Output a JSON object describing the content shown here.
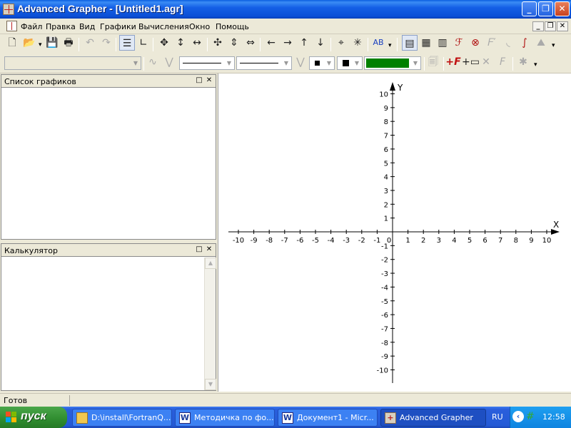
{
  "window": {
    "title": "Advanced Grapher - [Untitled1.agr]",
    "buttons": {
      "minimize": "_",
      "maximize": "❐",
      "close": "✕"
    }
  },
  "menu": {
    "items": [
      "Файл",
      "Правка",
      "Вид",
      "Графики",
      "Вычисления",
      "Окно",
      "Помощь"
    ],
    "mdi": {
      "minimize": "_",
      "restore": "❐",
      "close": "✕"
    }
  },
  "toolbar1": {
    "format_label": "AB"
  },
  "panels": {
    "graphs_list": {
      "title": "Список графиков"
    },
    "calculator": {
      "title": "Калькулятор"
    }
  },
  "graph": {
    "x_axis_label": "X",
    "y_axis_label": "Y",
    "x_ticks": [
      -10,
      -9,
      -8,
      -7,
      -6,
      -5,
      -4,
      -3,
      -2,
      -1,
      0,
      1,
      2,
      3,
      4,
      5,
      6,
      7,
      8,
      9,
      10
    ],
    "y_ticks": [
      -10,
      -9,
      -8,
      -7,
      -6,
      -5,
      -4,
      -3,
      -2,
      -1,
      1,
      2,
      3,
      4,
      5,
      6,
      7,
      8,
      9,
      10
    ],
    "xlim": [
      -10,
      10
    ],
    "ylim": [
      -10,
      10
    ]
  },
  "colors": {
    "line_color": "#008000"
  },
  "status": {
    "text": "Готов"
  },
  "taskbar": {
    "start_label": "пуск",
    "tasks": [
      {
        "label": "D:\\install\\FortranQ...",
        "icon": "folder-icon"
      },
      {
        "label": "Методичка по фо...",
        "icon": "word-icon"
      },
      {
        "label": "Документ1 - Micr...",
        "icon": "word-icon"
      },
      {
        "label": "Advanced Grapher",
        "icon": "grapher-icon"
      }
    ],
    "language": "RU",
    "clock": "12:58"
  }
}
